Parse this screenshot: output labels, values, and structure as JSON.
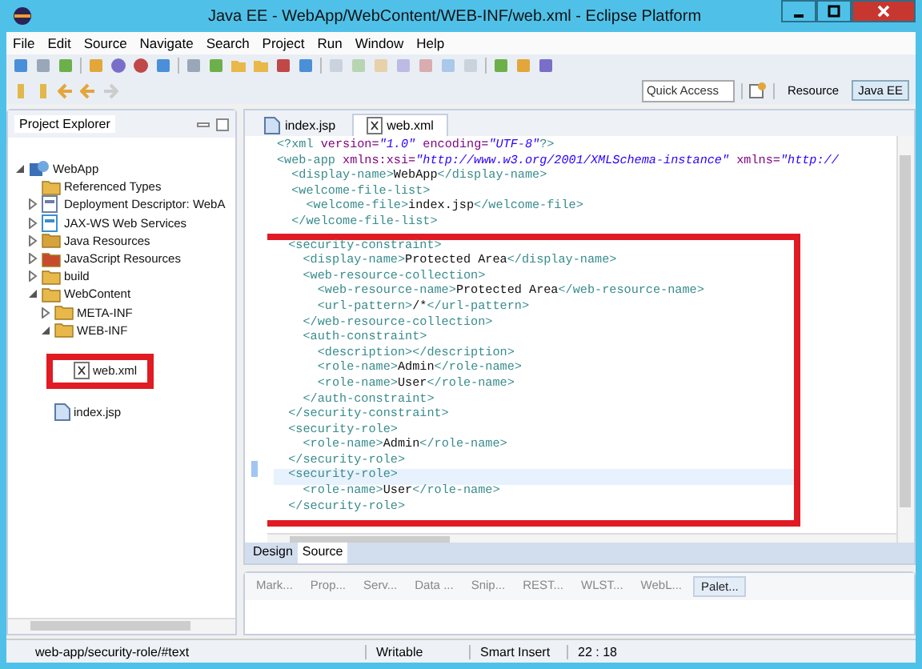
{
  "window": {
    "title": "Java EE - WebApp/WebContent/WEB-INF/web.xml - Eclipse Platform"
  },
  "menu": [
    "File",
    "Edit",
    "Source",
    "Navigate",
    "Search",
    "Project",
    "Run",
    "Window",
    "Help"
  ],
  "quick_access": {
    "placeholder": "Quick Access"
  },
  "perspectives": [
    {
      "label": "Resource",
      "selected": false
    },
    {
      "label": "Java EE",
      "selected": true
    }
  ],
  "project_explorer": {
    "title": "Project Explorer",
    "tree": [
      {
        "label": "WebApp",
        "kind": "project",
        "expanded": true,
        "children": [
          {
            "label": "Referenced Types",
            "kind": "folder"
          },
          {
            "label": "Deployment Descriptor: WebA",
            "kind": "descriptor",
            "expanded": false
          },
          {
            "label": "JAX-WS Web Services",
            "kind": "service",
            "expanded": false
          },
          {
            "label": "Java Resources",
            "kind": "library",
            "expanded": false
          },
          {
            "label": "JavaScript Resources",
            "kind": "script",
            "expanded": false
          },
          {
            "label": "build",
            "kind": "folder",
            "expanded": false
          },
          {
            "label": "WebContent",
            "kind": "folder",
            "expanded": true,
            "children": [
              {
                "label": "META-INF",
                "kind": "folder",
                "expanded": false
              },
              {
                "label": "WEB-INF",
                "kind": "folder",
                "expanded": true,
                "children": [
                  {
                    "label": "web.xml",
                    "kind": "xml",
                    "annotated": true
                  }
                ]
              },
              {
                "label": "index.jsp",
                "kind": "jsp"
              }
            ]
          }
        ]
      }
    ]
  },
  "editor_tabs": [
    {
      "label": "index.jsp",
      "kind": "jsp",
      "selected": false
    },
    {
      "label": "web.xml",
      "kind": "xml",
      "selected": true
    }
  ],
  "code": [
    {
      "boxed": false,
      "lines": [
        {
          "current": false,
          "tokens": [
            {
              "kind": "tag",
              "text": "<?xml "
            },
            {
              "kind": "attr",
              "text": "version="
            },
            {
              "kind": "value",
              "text": "\"1.0\""
            },
            {
              "kind": "attr",
              "text": " encoding="
            },
            {
              "kind": "value",
              "text": "\"UTF-8\""
            },
            {
              "kind": "tag",
              "text": "?>"
            }
          ]
        },
        {
          "current": false,
          "tokens": [
            {
              "kind": "tag",
              "text": "<web-app "
            },
            {
              "kind": "attr",
              "text": "xmlns:xsi="
            },
            {
              "kind": "value",
              "text": "\"http://www.w3.org/2001/XMLSchema-instance\""
            },
            {
              "kind": "attr",
              "text": " xmlns="
            },
            {
              "kind": "value",
              "text": "\"http://"
            }
          ]
        },
        {
          "current": false,
          "tokens": [
            {
              "kind": "tag",
              "text": "  <display-name>"
            },
            {
              "kind": "text",
              "text": "WebApp"
            },
            {
              "kind": "tag",
              "text": "</display-name>"
            }
          ]
        },
        {
          "current": false,
          "tokens": [
            {
              "kind": "tag",
              "text": "  <welcome-file-list>"
            }
          ]
        },
        {
          "current": false,
          "tokens": [
            {
              "kind": "tag",
              "text": "    <welcome-file>"
            },
            {
              "kind": "text",
              "text": "index.jsp"
            },
            {
              "kind": "tag",
              "text": "</welcome-file>"
            }
          ]
        },
        {
          "current": false,
          "tokens": [
            {
              "kind": "tag",
              "text": "  </welcome-file-list>"
            }
          ]
        }
      ]
    },
    {
      "boxed": true,
      "lines": [
        {
          "current": false,
          "tokens": [
            {
              "kind": "tag",
              "text": "  <security-constraint>"
            }
          ]
        },
        {
          "current": false,
          "tokens": [
            {
              "kind": "tag",
              "text": "    <display-name>"
            },
            {
              "kind": "text",
              "text": "Protected Area"
            },
            {
              "kind": "tag",
              "text": "</display-name>"
            }
          ]
        },
        {
          "current": false,
          "tokens": [
            {
              "kind": "tag",
              "text": "    <web-resource-collection>"
            }
          ]
        },
        {
          "current": false,
          "tokens": [
            {
              "kind": "tag",
              "text": "      <web-resource-name>"
            },
            {
              "kind": "text",
              "text": "Protected Area"
            },
            {
              "kind": "tag",
              "text": "</web-resource-name>"
            }
          ]
        },
        {
          "current": false,
          "tokens": [
            {
              "kind": "tag",
              "text": "      <url-pattern>"
            },
            {
              "kind": "text",
              "text": "/*"
            },
            {
              "kind": "tag",
              "text": "</url-pattern>"
            }
          ]
        },
        {
          "current": false,
          "tokens": [
            {
              "kind": "tag",
              "text": "    </web-resource-collection>"
            }
          ]
        },
        {
          "current": false,
          "tokens": [
            {
              "kind": "tag",
              "text": "    <auth-constraint>"
            }
          ]
        },
        {
          "current": false,
          "tokens": [
            {
              "kind": "tag",
              "text": "      <description></description>"
            }
          ]
        },
        {
          "current": false,
          "tokens": [
            {
              "kind": "tag",
              "text": "      <role-name>"
            },
            {
              "kind": "text",
              "text": "Admin"
            },
            {
              "kind": "tag",
              "text": "</role-name>"
            }
          ]
        },
        {
          "current": false,
          "tokens": [
            {
              "kind": "tag",
              "text": "      <role-name>"
            },
            {
              "kind": "text",
              "text": "User"
            },
            {
              "kind": "tag",
              "text": "</role-name>"
            }
          ]
        },
        {
          "current": false,
          "tokens": [
            {
              "kind": "tag",
              "text": "    </auth-constraint>"
            }
          ]
        },
        {
          "current": false,
          "tokens": [
            {
              "kind": "tag",
              "text": "  </security-constraint>"
            }
          ]
        },
        {
          "current": false,
          "tokens": [
            {
              "kind": "tag",
              "text": "  <security-role>"
            }
          ]
        },
        {
          "current": false,
          "tokens": [
            {
              "kind": "tag",
              "text": "    <role-name>"
            },
            {
              "kind": "text",
              "text": "Admin"
            },
            {
              "kind": "tag",
              "text": "</role-name>"
            }
          ]
        },
        {
          "current": false,
          "tokens": [
            {
              "kind": "tag",
              "text": "  </security-role>"
            }
          ]
        },
        {
          "current": true,
          "tokens": [
            {
              "kind": "tag",
              "text": "  <security-role>"
            }
          ]
        },
        {
          "current": false,
          "tokens": [
            {
              "kind": "tag",
              "text": "    <role-name>"
            },
            {
              "kind": "text",
              "text": "User"
            },
            {
              "kind": "tag",
              "text": "</role-name>"
            }
          ]
        },
        {
          "current": false,
          "tokens": [
            {
              "kind": "tag",
              "text": "  </security-role>"
            }
          ]
        }
      ]
    }
  ],
  "editor_modes": [
    {
      "label": "Design",
      "selected": false
    },
    {
      "label": "Source",
      "selected": true
    }
  ],
  "bottom_tabs": [
    {
      "label": "Mark...",
      "selected": false
    },
    {
      "label": "Prop...",
      "selected": false
    },
    {
      "label": "Serv...",
      "selected": false
    },
    {
      "label": "Data ...",
      "selected": false
    },
    {
      "label": "Snip...",
      "selected": false
    },
    {
      "label": "REST...",
      "selected": false
    },
    {
      "label": "WLST...",
      "selected": false
    },
    {
      "label": "WebL...",
      "selected": false
    },
    {
      "label": "Palet...",
      "selected": true
    }
  ],
  "status_bar": {
    "path": "web-app/security-role/#text",
    "mode": "Writable",
    "insert": "Smart Insert",
    "position": "22 : 18"
  }
}
